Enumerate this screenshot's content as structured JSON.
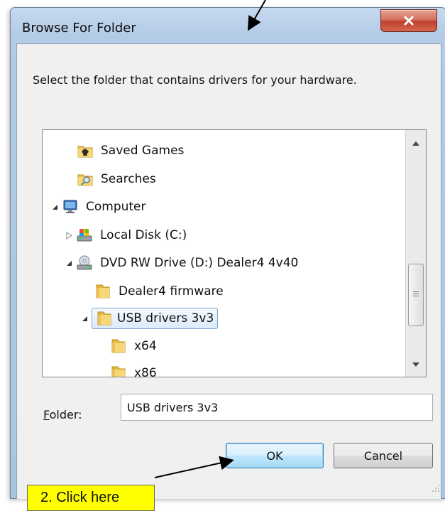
{
  "window": {
    "title": "Browse For Folder",
    "close_glyph": "X"
  },
  "instruction": "Select the folder that contains drivers for your hardware.",
  "tree": {
    "items": [
      {
        "label": "Saved Games",
        "icon": "saved-games-folder-icon",
        "expander": "none"
      },
      {
        "label": "Searches",
        "icon": "searches-folder-icon",
        "expander": "none"
      },
      {
        "label": "Computer",
        "icon": "computer-icon",
        "expander": "expanded"
      },
      {
        "label": "Local Disk (C:)",
        "icon": "local-disk-icon",
        "expander": "collapsed"
      },
      {
        "label": "DVD RW Drive (D:) Dealer4 4v40",
        "icon": "dvd-drive-icon",
        "expander": "expanded"
      },
      {
        "label": "Dealer4 firmware",
        "icon": "folder-icon",
        "expander": "none"
      },
      {
        "label": "USB drivers 3v3",
        "icon": "folder-icon",
        "expander": "expanded",
        "selected": true
      },
      {
        "label": "x64",
        "icon": "folder-icon",
        "expander": "none"
      },
      {
        "label": "x86",
        "icon": "folder-icon",
        "expander": "none"
      }
    ]
  },
  "folder": {
    "label_prefix": "F",
    "label_rest": "older:",
    "value": "USB drivers 3v3"
  },
  "buttons": {
    "ok": "OK",
    "cancel": "Cancel"
  },
  "annotation": {
    "callout": "2. Click here"
  },
  "colors": {
    "selection_border": "#7da2ce",
    "callout_bg": "#ffff00",
    "close_button": "#c0402c"
  }
}
